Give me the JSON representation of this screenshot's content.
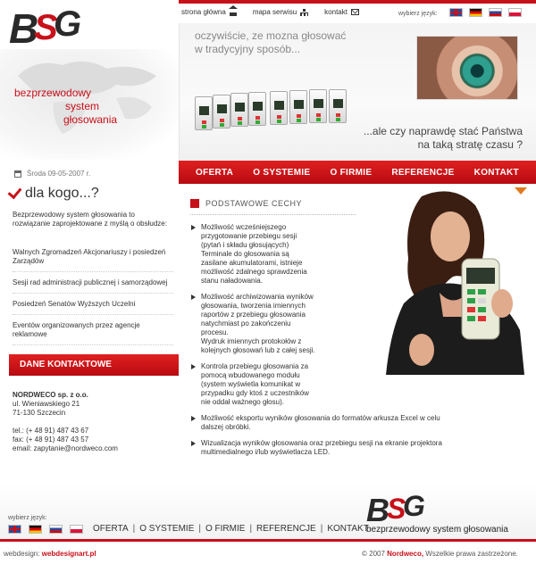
{
  "topnav": {
    "home_label": "strona główna",
    "sitemap_label": "mapa serwisu",
    "contact_label": "kontakt",
    "language_label": "wybierz język:"
  },
  "logo": {
    "text": "BSG"
  },
  "header": {
    "tagline_left": [
      "bezprzewodowy",
      "system",
      "głosowania"
    ],
    "banner_line1a": "oczywiście, ze mozna głosować",
    "banner_line1b": "w tradycyjny sposób...",
    "banner_line2a": "...ale czy naprawdę stać Państwa",
    "banner_line2b": "na taką stratę czasu ?"
  },
  "menu": [
    "OFERTA",
    "O SYSTEMIE",
    "O FIRMIE",
    "REFERENCJE",
    "KONTAKT"
  ],
  "left": {
    "date": "Środa 09-05-2007 r.",
    "heading": "dla kogo...?",
    "intro": "Bezprzewodowy system głosowania to rozwiązanie zaprojektowane z myślą o obsłudze:",
    "targets": [
      "Walnych Zgromadzeń Akcjonariuszy i posiedzeń Zarządów",
      "Sesji rad administracji publicznej i samorządowej",
      "Posiedzeń Senatów Wyższych Uczelni",
      "Eventów organizowanych przez agencje reklamowe"
    ],
    "contact_heading": "DANE KONTAKTOWE",
    "company": "NORDWECO sp. z o.o.",
    "street": "ul. Wieniawskiego 21",
    "city": "71-130 Szczecin",
    "tel": "tel.: (+ 48 91) 487 43 67",
    "fax": "fax: (+ 48 91) 487 43 57",
    "email": "email: zapytanie@nordweco.com"
  },
  "content": {
    "heading": "PODSTAWOWE CECHY",
    "features": [
      "Możliwość wcześniejszego\nprzygotowanie przebiegu sesji\n(pytań i składu głosujących)\nTerminale do głosowania są\nzasilane akumulatorami, istnieje\nmożliwość zdalnego sprawdzenia\nstanu naładowania.",
      "Możliwość archiwizowania wyników\ngłosowania, tworzenia imiennych\nraportów z przebiegu głosowania\nnatychmiast po zakończeniu\nprocesu.\nWydruk imiennych protokołów z\nkolejnych głosowań lub z całej sesji.",
      "Kontrola przebiegu głosowania za\npomocą wbudowanego modułu\n(system wyświetla komunikat w\nprzypadku gdy ktoś z uczestników\nnie oddał ważnego głosu).",
      "Możliwość eksportu wyników głosowania do formatów arkusza Excel w celu\ndalszej obróbki.",
      "Wizualizacja wyników głosowania oraz przebiegu sesji na ekranie projektora\nmultimedialnego i/lub wyświetlacza LED."
    ]
  },
  "footer": {
    "language_label": "wybierz język:",
    "menu": [
      "OFERTA",
      "O SYSTEMIE",
      "O FIRMIE",
      "REFERENCJE",
      "KONTAKT"
    ],
    "logo_text": "BSG",
    "logo_caption": "bezprzewodowy system głosowania",
    "webdesign_label": "webdesign:",
    "webdesign_link": "webdesignart.pl",
    "copyright_pre": "© 2007",
    "copyright_brand": "Nordweco,",
    "copyright_post": "Wszelkie prawa zastrzeżone."
  },
  "colors": {
    "accent": "#c8101a",
    "menu_red": "#d8141c",
    "arrow_orange": "#e07a20"
  }
}
